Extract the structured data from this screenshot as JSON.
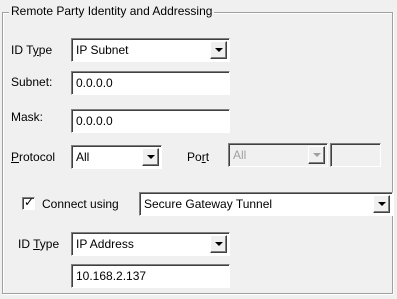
{
  "group": {
    "title": "Remote Party Identity and Addressing"
  },
  "id_type_1": {
    "label_prefix": "ID T",
    "label_accel": "y",
    "label_suffix": "pe",
    "value": "IP Subnet"
  },
  "subnet": {
    "label": "Subnet:",
    "value": "0.0.0.0"
  },
  "mask": {
    "label": "Mask:",
    "value": "0.0.0.0"
  },
  "protocol": {
    "label_accel": "P",
    "label_suffix": "rotocol",
    "value": "All"
  },
  "port": {
    "label_prefix": "Po",
    "label_accel": "r",
    "label_suffix": "t",
    "value": "All",
    "extra_value": ""
  },
  "connect": {
    "checked": true,
    "check_glyph": "✓",
    "label": "Connect using",
    "value": "Secure Gateway Tunnel"
  },
  "id_type_2": {
    "label_prefix": "ID ",
    "label_accel": "T",
    "label_suffix": "ype",
    "value": "IP Address",
    "address_value": "10.168.2.137"
  }
}
